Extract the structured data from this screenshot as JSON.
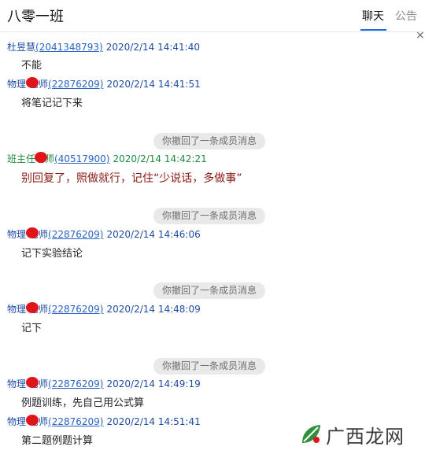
{
  "header": {
    "title": "八零一班",
    "tab_chat": "聊天",
    "tab_notice": "公告",
    "close_glyph": "×"
  },
  "messages": [
    {
      "name": "杜昱慧",
      "qq": "(2041348793)",
      "time": "2020/2/14 14:41:40",
      "text": "不能"
    },
    {
      "name": "物理",
      "name_suffix": "老师",
      "qq": "(22876209)",
      "time": "2020/2/14 14:41:51",
      "text": "将笔记记下来"
    },
    {
      "recall": "你撤回了一条成员消息"
    },
    {
      "name": "班主任",
      "name_suffix": "老师",
      "qq": "(40517900)",
      "time": "2020/2/14 14:42:21",
      "text": "别回复了，照做就行，记住“少说话，多做事”"
    },
    {
      "recall": "你撤回了一条成员消息"
    },
    {
      "name": "物理",
      "name_suffix": "老师",
      "qq": "(22876209)",
      "time": "2020/2/14 14:46:06",
      "text": "记下实验结论"
    },
    {
      "recall": "你撤回了一条成员消息"
    },
    {
      "name": "物理",
      "name_suffix": "老师",
      "qq": "(22876209)",
      "time": "2020/2/14 14:48:09",
      "text": "记下"
    },
    {
      "recall": "你撤回了一条成员消息"
    },
    {
      "name": "物理",
      "name_suffix": "老师",
      "qq": "(22876209)",
      "time": "2020/2/14 14:49:19",
      "text": "例题训练，先自己用公式算"
    },
    {
      "name": "物理",
      "name_suffix": "老师",
      "qq": "(22876209)",
      "time": "2020/2/14 14:51:41",
      "text": "第二题例题计算"
    }
  ],
  "watermark": {
    "text": "广西龙网",
    "logo": "leaf-logo-icon"
  },
  "colors": {
    "sender_blue": "#1e4da6",
    "sender_green": "#1e8a3c",
    "link": "#2a64c4",
    "highlight_text": "#8a1a14",
    "recall_bg": "#e9e9e9",
    "tab_accent": "#1e6fd9",
    "redaction": "#e0151b"
  }
}
